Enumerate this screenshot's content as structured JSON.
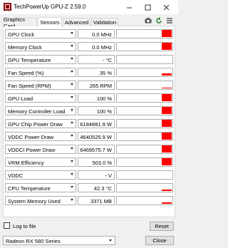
{
  "window": {
    "title": "TechPowerUp GPU-Z 2.59.0",
    "icon": "gpu-z-app-icon",
    "controls": [
      "minimize",
      "maximize",
      "close"
    ]
  },
  "tabs": [
    {
      "label": "Graphics Card",
      "active": false
    },
    {
      "label": "Sensors",
      "active": true
    },
    {
      "label": "Advanced",
      "active": false
    },
    {
      "label": "Validation",
      "active": false
    }
  ],
  "toolbar": {
    "icons": [
      "camera-icon",
      "refresh-icon",
      "menu-icon"
    ]
  },
  "sensors": [
    {
      "label": "GPU Clock",
      "value": "0.0 MHz",
      "graph_level": 1.0
    },
    {
      "label": "Memory Clock",
      "value": "0.0 MHz",
      "graph_level": 1.0
    },
    {
      "label": "GPU Temperature",
      "value": "- °C",
      "graph_level": 0
    },
    {
      "label": "Fan Speed (%)",
      "value": "35 %",
      "graph_level": 0.25
    },
    {
      "label": "Fan Speed (RPM)",
      "value": "265 RPM",
      "graph_level": 0.1
    },
    {
      "label": "GPU Load",
      "value": "100 %",
      "graph_level": 1.0
    },
    {
      "label": "Memory Controller Load",
      "value": "100 %",
      "graph_level": 1.0
    },
    {
      "label": "GPU Chip Power Draw",
      "value": "6184881.9 W",
      "graph_level": 1.0
    },
    {
      "label": "VDDC Power Draw",
      "value": "4640525.9 W",
      "graph_level": 1.0
    },
    {
      "label": "VDDCI Power Draw",
      "value": "6469575.7 W",
      "graph_level": 1.0
    },
    {
      "label": "VRM Efficiency",
      "value": "503.0 %",
      "graph_level": 1.0
    },
    {
      "label": "VDDC",
      "value": "- V",
      "graph_level": 0
    },
    {
      "label": "CPU Temperature",
      "value": "42.3 °C",
      "graph_level": 0.2
    },
    {
      "label": "System Memory Used",
      "value": "3371 MB",
      "graph_level": 0.15
    }
  ],
  "footer": {
    "log_to_file_label": "Log to file",
    "log_to_file_checked": false,
    "reset_label": "Reset",
    "gpu_select_value": "Radeon RX 580 Series",
    "close_label": "Close"
  },
  "colors": {
    "graph_bar": "#ff0000",
    "active_tab": "#ffffff",
    "window_bg": "#f0f0f0"
  }
}
